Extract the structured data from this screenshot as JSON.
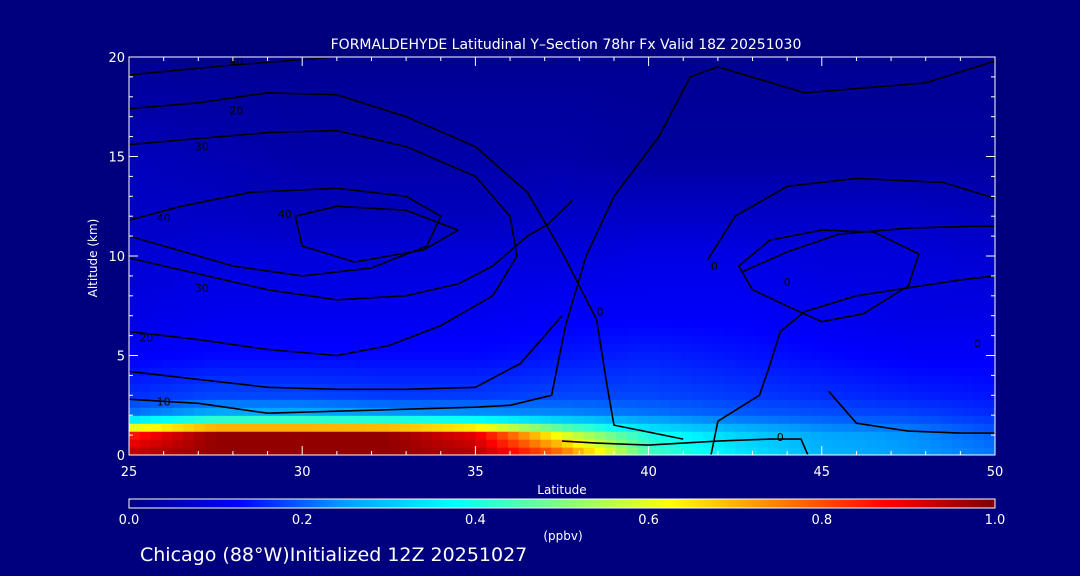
{
  "chart_data": {
    "type": "heatmap",
    "title": "FORMALDEHYDE Latitudinal Y–Section 78hr  Fx Valid 18Z 20251030",
    "xlabel": "Latitude",
    "ylabel": "Altitude (km)",
    "xlim": [
      25,
      50
    ],
    "ylim": [
      0,
      20
    ],
    "x_ticks": [
      "25",
      "30",
      "35",
      "40",
      "45",
      "50"
    ],
    "y_ticks": [
      "0",
      "5",
      "10",
      "15",
      "20"
    ],
    "colorbar": {
      "unit": "(ppbv)",
      "ticks": [
        "0.0",
        "0.2",
        "0.4",
        "0.6",
        "0.8",
        "1.0"
      ],
      "range": [
        0,
        1
      ],
      "colors": [
        "#00007f",
        "#0000ff",
        "#00a0ff",
        "#00ffff",
        "#7fff7f",
        "#ffff00",
        "#ff8000",
        "#ff0000",
        "#7f0000"
      ]
    },
    "field": {
      "latitudes": [
        25,
        27.5,
        30,
        32.5,
        35,
        37.5,
        40,
        42.5,
        45,
        47.5,
        50
      ],
      "altitudes": [
        0,
        1,
        2,
        3,
        5,
        7,
        10,
        12,
        15,
        20
      ],
      "values": [
        [
          0.95,
          0.98,
          0.98,
          0.98,
          0.96,
          0.8,
          0.45,
          0.35,
          0.28,
          0.25,
          0.22
        ],
        [
          0.85,
          0.98,
          0.98,
          0.98,
          0.9,
          0.6,
          0.4,
          0.32,
          0.26,
          0.24,
          0.2
        ],
        [
          0.22,
          0.28,
          0.28,
          0.26,
          0.25,
          0.24,
          0.22,
          0.2,
          0.19,
          0.18,
          0.16
        ],
        [
          0.16,
          0.18,
          0.18,
          0.17,
          0.17,
          0.18,
          0.18,
          0.17,
          0.16,
          0.15,
          0.14
        ],
        [
          0.12,
          0.13,
          0.13,
          0.13,
          0.13,
          0.14,
          0.15,
          0.14,
          0.13,
          0.12,
          0.12
        ],
        [
          0.1,
          0.11,
          0.11,
          0.11,
          0.11,
          0.12,
          0.12,
          0.12,
          0.11,
          0.1,
          0.1
        ],
        [
          0.08,
          0.09,
          0.09,
          0.09,
          0.09,
          0.09,
          0.1,
          0.1,
          0.09,
          0.09,
          0.08
        ],
        [
          0.07,
          0.07,
          0.06,
          0.06,
          0.06,
          0.07,
          0.07,
          0.07,
          0.07,
          0.07,
          0.06
        ],
        [
          0.06,
          0.05,
          0.04,
          0.04,
          0.04,
          0.04,
          0.03,
          0.03,
          0.03,
          0.03,
          0.03
        ],
        [
          0.02,
          0.02,
          0.02,
          0.02,
          0.02,
          0.02,
          0.02,
          0.02,
          0.02,
          0.02,
          0.02
        ]
      ]
    },
    "contours": [
      {
        "label": "40",
        "points": [
          [
            25,
            19.1
          ],
          [
            28,
            19.6
          ],
          [
            31,
            20
          ]
        ],
        "label_at": [
          28.1,
          19.8
        ]
      },
      {
        "label": "20",
        "points": [
          [
            25,
            17.4
          ],
          [
            27,
            17.7
          ],
          [
            29,
            18.2
          ],
          [
            31,
            18.1
          ],
          [
            33,
            17
          ],
          [
            35,
            15.5
          ],
          [
            36.5,
            13.2
          ],
          [
            37.5,
            10.2
          ],
          [
            38.5,
            6.8
          ],
          [
            38.8,
            3.5
          ],
          [
            39,
            1.5
          ],
          [
            41,
            0.8
          ]
        ],
        "label_at": [
          28.1,
          17.3
        ]
      },
      {
        "label": "30",
        "points": [
          [
            25,
            15.6
          ],
          [
            27,
            15.9
          ],
          [
            29,
            16.2
          ],
          [
            31,
            16.3
          ],
          [
            33,
            15.5
          ],
          [
            35,
            14
          ],
          [
            36,
            12
          ],
          [
            36.2,
            10
          ],
          [
            35.5,
            8
          ],
          [
            34,
            6.5
          ],
          [
            32.5,
            5.5
          ],
          [
            31,
            5
          ],
          [
            29,
            5.3
          ],
          [
            27,
            5.8
          ],
          [
            25,
            6.2
          ]
        ],
        "label_at": [
          27.1,
          15.5
        ]
      },
      {
        "label": "10",
        "points": [
          [
            25,
            2.8
          ],
          [
            27,
            2.6
          ],
          [
            29,
            2.1
          ],
          [
            31,
            2.2
          ],
          [
            33,
            2.3
          ],
          [
            35,
            2.4
          ],
          [
            36,
            2.5
          ],
          [
            37.2,
            3
          ],
          [
            37.6,
            6.5
          ],
          [
            38.2,
            10
          ],
          [
            39,
            13
          ],
          [
            40.3,
            16
          ],
          [
            41.2,
            19
          ],
          [
            42,
            19.5
          ],
          [
            44.5,
            18.2
          ],
          [
            48,
            18.7
          ],
          [
            50,
            19.8
          ]
        ],
        "label_at": [
          26,
          2.7
        ]
      },
      {
        "label": "40",
        "points": [
          [
            25,
            11.8
          ],
          [
            26.5,
            12.5
          ],
          [
            28.5,
            13.2
          ],
          [
            31,
            13.4
          ],
          [
            33,
            13
          ],
          [
            34,
            12
          ],
          [
            33.6,
            10.5
          ],
          [
            32,
            9.4
          ],
          [
            30,
            9
          ],
          [
            28,
            9.5
          ],
          [
            26,
            10.5
          ],
          [
            25,
            11
          ]
        ],
        "label_at": [
          26,
          11.9
        ]
      },
      {
        "label": "40",
        "points": [
          [
            29.8,
            12
          ],
          [
            31,
            12.5
          ],
          [
            33,
            12.3
          ],
          [
            34.5,
            11.3
          ],
          [
            33.5,
            10.3
          ],
          [
            31.5,
            9.7
          ],
          [
            30,
            10.5
          ],
          [
            29.8,
            12
          ]
        ],
        "label_at": [
          29.5,
          12.1
        ]
      },
      {
        "label": "30",
        "points": [
          [
            25,
            9.9
          ],
          [
            27,
            9.1
          ],
          [
            29,
            8.3
          ],
          [
            31,
            7.8
          ],
          [
            33,
            8
          ],
          [
            34.5,
            8.6
          ],
          [
            35.5,
            9.5
          ],
          [
            36.5,
            11
          ],
          [
            37.1,
            11.6
          ],
          [
            37.8,
            12.8
          ]
        ],
        "label_at": [
          27.1,
          8.4
        ]
      },
      {
        "label": "20",
        "points": [
          [
            25,
            4.2
          ],
          [
            27,
            3.8
          ],
          [
            29,
            3.4
          ],
          [
            31,
            3.3
          ],
          [
            33,
            3.3
          ],
          [
            35,
            3.4
          ],
          [
            36.3,
            4.6
          ],
          [
            37.5,
            7
          ]
        ],
        "label_at": [
          25.5,
          5.9
        ]
      },
      {
        "label": "0",
        "points": [
          [
            37.5,
            0.7
          ],
          [
            38.5,
            0.6
          ],
          [
            40,
            0.5
          ],
          [
            42,
            0.7
          ],
          [
            43.5,
            0.8
          ],
          [
            44.4,
            0.8
          ],
          [
            44.6,
            0
          ]
        ],
        "label_at": [
          43.8,
          0.9
        ]
      },
      {
        "label": "0",
        "points": [
          [
            41.8,
            0
          ],
          [
            42,
            1.7
          ],
          [
            43.2,
            3
          ],
          [
            43.5,
            4.5
          ],
          [
            43.8,
            6.2
          ],
          [
            44.5,
            7.2
          ],
          [
            46,
            8
          ],
          [
            47.5,
            8.4
          ],
          [
            49,
            8.8
          ],
          [
            50,
            9
          ]
        ],
        "label_at": [
          41.9,
          9.5
        ]
      },
      {
        "label": "0",
        "points": [
          [
            42.7,
            9.2
          ],
          [
            44,
            10.2
          ],
          [
            45.5,
            11.1
          ],
          [
            47.5,
            11.4
          ],
          [
            49.5,
            11.5
          ],
          [
            50,
            11.5
          ]
        ],
        "label_at": [
          44,
          8.7
        ]
      },
      {
        "label": "0",
        "points": [
          [
            41.7,
            9.8
          ],
          [
            42.5,
            12
          ],
          [
            44,
            13.5
          ],
          [
            46,
            13.9
          ],
          [
            48.5,
            13.7
          ],
          [
            50,
            12.9
          ]
        ],
        "label_at": [
          38.6,
          7.2
        ]
      },
      {
        "label": "0",
        "points": [
          [
            42.6,
            9.5
          ],
          [
            43.5,
            10.8
          ],
          [
            45,
            11.3
          ],
          [
            46.5,
            11.2
          ],
          [
            47.8,
            10.1
          ],
          [
            47.5,
            8.5
          ],
          [
            46.2,
            7.1
          ],
          [
            45,
            6.7
          ],
          [
            44.1,
            7.4
          ],
          [
            43,
            8.3
          ],
          [
            42.6,
            9.5
          ]
        ],
        "label_at": [
          49.5,
          5.6
        ]
      },
      {
        "label": "",
        "points": [
          [
            45.2,
            3.2
          ],
          [
            46,
            1.6
          ],
          [
            47.5,
            1.2
          ],
          [
            49,
            1.1
          ],
          [
            50,
            1.1
          ]
        ],
        "label_at": [
          47,
          1.2
        ]
      }
    ]
  },
  "footer": {
    "location": "Chicago (88°W)",
    "initialized": "Initialized 12Z 20251027"
  }
}
